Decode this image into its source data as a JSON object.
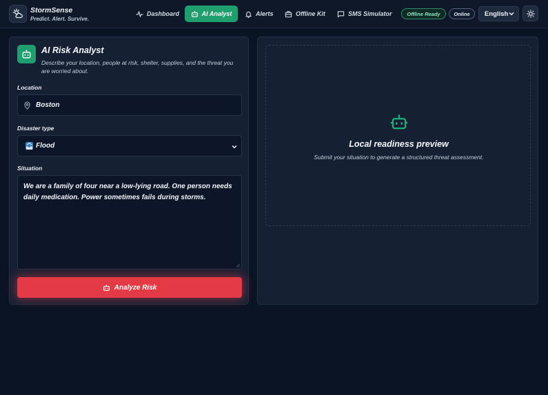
{
  "brand": {
    "title": "StormSense",
    "tagline": "Predict. Alert. Survive.",
    "logo_icon": "storm-cloud-icon"
  },
  "nav": [
    {
      "label": "Dashboard",
      "icon": "activity-icon",
      "active": false
    },
    {
      "label": "AI Analyst",
      "icon": "robot-icon",
      "active": true
    },
    {
      "label": "Alerts",
      "icon": "bell-icon",
      "active": false
    },
    {
      "label": "Offline Kit",
      "icon": "briefcase-icon",
      "active": false
    },
    {
      "label": "SMS Simulator",
      "icon": "message-icon",
      "active": false
    }
  ],
  "status": {
    "offline_ready": "Offline Ready",
    "online": "Online"
  },
  "language": {
    "selected": "English"
  },
  "theme_toggle_icon": "sun-icon",
  "analyst": {
    "title": "AI Risk Analyst",
    "description": "Describe your location, people at risk, shelter, supplies, and the threat you are worried about.",
    "location_label": "Location",
    "location_value": "Boston",
    "disaster_label": "Disaster type",
    "disaster_value": "Flood",
    "situation_label": "Situation",
    "situation_value": "We are a family of four near a low-lying road. One person needs daily medication. Power sometimes fails during storms.",
    "analyze_label": "Analyze Risk"
  },
  "preview": {
    "title": "Local readiness preview",
    "subtitle": "Submit your situation to generate a structured threat assessment."
  },
  "colors": {
    "accent_green": "#1f9e6e",
    "danger_red": "#e33a46",
    "background": "#0b1424",
    "panel": "#162033"
  }
}
